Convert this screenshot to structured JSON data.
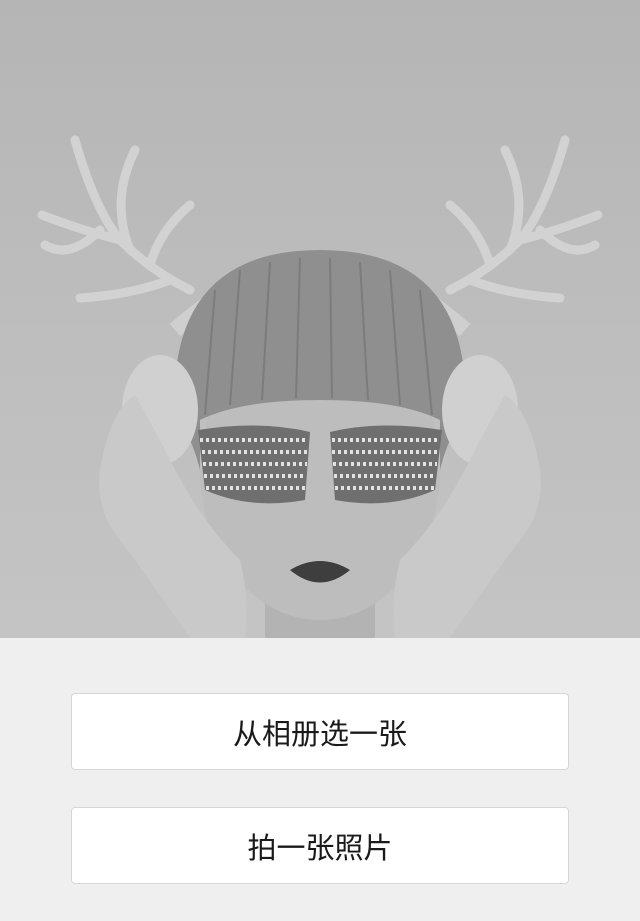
{
  "preview": {
    "image_alt": "photo-preview",
    "background_color": "#b9b9b9"
  },
  "actions": {
    "choose_from_album": "从相册选一张",
    "take_photo": "拍一张照片"
  },
  "colors": {
    "page_background": "#efefef",
    "button_background": "#ffffff",
    "button_border": "#d6d6d6",
    "button_text": "#1a1a1a"
  }
}
